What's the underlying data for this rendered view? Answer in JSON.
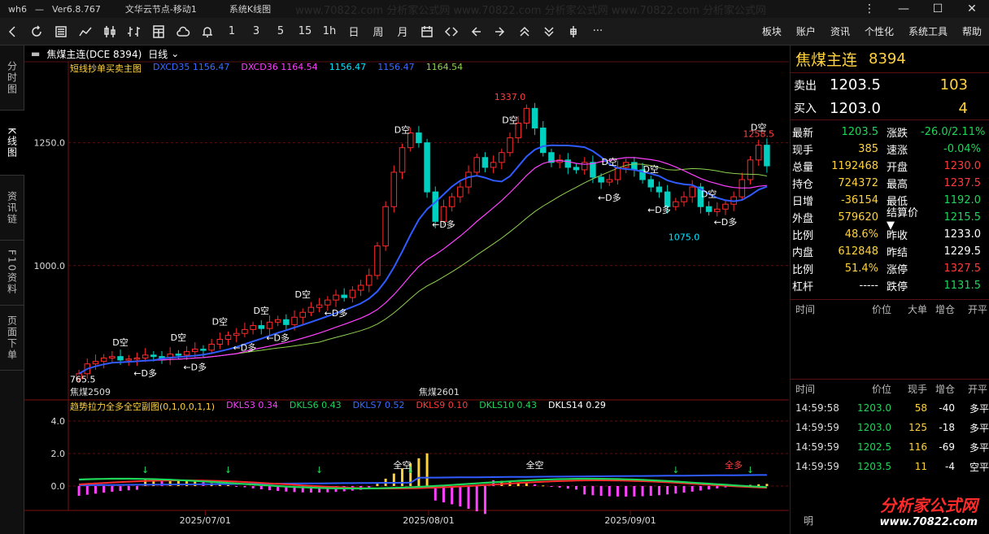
{
  "titlebar": {
    "app": "wh6",
    "dash": "—",
    "version": "Ver6.8.767",
    "tab1": "文华云节点-移动1",
    "tab2": "系统K线图",
    "watermark": "www.70822.com 分析家公式网 www.70822.com 分析家公式网 www.70822.com 分析家公式网"
  },
  "toolbar": {
    "periods": [
      "1",
      "3",
      "5",
      "15",
      "1h",
      "日",
      "周",
      "月"
    ],
    "menus": [
      "板块",
      "账户",
      "资讯",
      "个性化",
      "系统工具",
      "帮助"
    ],
    "more": "···"
  },
  "sidetabs": [
    "分时图",
    "K线图",
    "资讯链",
    "F10资料",
    "页面下单"
  ],
  "chart_header": {
    "symbol": "焦煤主连(DCE 8394)",
    "period": "日线"
  },
  "indicator_main": {
    "name": "短线抄单买卖主图",
    "items": [
      {
        "text": "DXCD35 1156.47",
        "color": "#3a6cff"
      },
      {
        "text": "DXCD36 1164.54",
        "color": "#ff40ff"
      },
      {
        "text": "1156.47",
        "color": "#00e5ff"
      },
      {
        "text": "1156.47",
        "color": "#3a6cff"
      },
      {
        "text": "1164.54",
        "color": "#8fd14f"
      }
    ]
  },
  "indicator_sub": {
    "name": "趋势拉力全多全空副图(0,1,0,0,1,1)",
    "items": [
      {
        "text": "DKLS3 0.34",
        "color": "#ff40ff"
      },
      {
        "text": "DKLS6 0.43",
        "color": "#1fd65a"
      },
      {
        "text": "DKLS7 0.52",
        "color": "#3a6cff"
      },
      {
        "text": "DKLS9 0.10",
        "color": "#ff3b3b"
      },
      {
        "text": "DKLS10 0.43",
        "color": "#1fd65a"
      },
      {
        "text": "DKLS14 0.29",
        "color": "#ffffff"
      }
    ]
  },
  "chart_labels": {
    "price_ticks": [
      "1250.0",
      "1000.0"
    ],
    "sub_ticks": [
      "4.0",
      "2.0",
      "0.0"
    ],
    "dates": [
      "2025/07/01",
      "2025/08/01",
      "2025/09/01"
    ],
    "contract1": "焦煤2509",
    "contract2": "焦煤2601",
    "high_label": "1258.5",
    "peak_label": "1337.0",
    "low_label": "1075.0",
    "start_label": "765.5",
    "d_kong": "D空",
    "d_duo": "←D多",
    "quan_kong": "全空",
    "quan_duo": "全多"
  },
  "chart_data": {
    "type": "candlestick",
    "title": "焦煤主连(DCE 8394) 日线",
    "x_ticks": [
      "2025/07/01",
      "2025/08/01",
      "2025/09/01"
    ],
    "y_ticks": [
      1250.0,
      1000.0
    ],
    "ylim": [
      740,
      1390
    ],
    "annotations": {
      "high": 1258.5,
      "peak": 1337.0,
      "low": 1075.0,
      "start": 765.5
    },
    "closes": [
      780,
      800,
      805,
      812,
      815,
      808,
      810,
      812,
      818,
      815,
      812,
      820,
      818,
      825,
      830,
      828,
      840,
      850,
      858,
      862,
      870,
      878,
      872,
      885,
      890,
      880,
      895,
      905,
      915,
      920,
      930,
      940,
      935,
      950,
      960,
      980,
      1040,
      1120,
      1190,
      1240,
      1270,
      1250,
      1150,
      1090,
      1120,
      1140,
      1160,
      1190,
      1220,
      1200,
      1210,
      1230,
      1260,
      1290,
      1320,
      1280,
      1230,
      1210,
      1215,
      1200,
      1195,
      1210,
      1180,
      1170,
      1175,
      1200,
      1210,
      1195,
      1175,
      1160,
      1150,
      1120,
      1130,
      1140,
      1160,
      1120,
      1110,
      1115,
      1125,
      1140,
      1175,
      1215,
      1245,
      1203
    ]
  },
  "right_panel": {
    "name": "焦煤主连",
    "code": "8394",
    "ask": {
      "label": "卖出",
      "price": "1203.5",
      "vol": "103"
    },
    "bid": {
      "label": "买入",
      "price": "1203.0",
      "vol": "4"
    },
    "quotes": [
      {
        "k": "最新",
        "v": "1203.5",
        "vc": "g",
        "k2": "涨跌",
        "v2": "-26.0/2.11%",
        "v2c": "g"
      },
      {
        "k": "现手",
        "v": "385",
        "vc": "y",
        "k2": "速涨",
        "v2": "-0.04%",
        "v2c": "g"
      },
      {
        "k": "总量",
        "v": "1192468",
        "vc": "y",
        "k2": "开盘",
        "v2": "1230.0",
        "v2c": "r"
      },
      {
        "k": "持仓",
        "v": "724372",
        "vc": "y",
        "k2": "最高",
        "v2": "1237.5",
        "v2c": "r"
      },
      {
        "k": "日增",
        "v": "-36154",
        "vc": "y",
        "k2": "最低",
        "v2": "1192.0",
        "v2c": "g"
      },
      {
        "k": "外盘",
        "v": "579620",
        "vc": "y",
        "k2": "结算价▼",
        "v2": "1215.5",
        "v2c": "g"
      },
      {
        "k": "比例",
        "v": "48.6%",
        "vc": "y",
        "k2": "昨收",
        "v2": "1233.0",
        "v2c": "w"
      },
      {
        "k": "内盘",
        "v": "612848",
        "vc": "y",
        "k2": "昨结",
        "v2": "1229.5",
        "v2c": "w"
      },
      {
        "k": "比例",
        "v": "51.4%",
        "vc": "y",
        "k2": "涨停",
        "v2": "1327.5",
        "v2c": "r"
      },
      {
        "k": "杠杆",
        "v": "-----",
        "vc": "w",
        "k2": "跌停",
        "v2": "1131.5",
        "v2c": "g"
      }
    ],
    "big_header": [
      "时间",
      "价位",
      "大单",
      "增仓",
      "开平"
    ],
    "tick_header": [
      "时间",
      "价位",
      "现手",
      "增仓",
      "开平"
    ],
    "ticks": [
      {
        "t": "14:59:58",
        "p": "1203.0",
        "pc": "g",
        "v": "58",
        "c": "-40",
        "k": "多平"
      },
      {
        "t": "14:59:59",
        "p": "1203.0",
        "pc": "g",
        "v": "125",
        "c": "-18",
        "k": "多平"
      },
      {
        "t": "14:59:59",
        "p": "1202.5",
        "pc": "g",
        "v": "116",
        "c": "-69",
        "k": "多平"
      },
      {
        "t": "14:59:59",
        "p": "1203.5",
        "pc": "g",
        "v": "11",
        "c": "-4",
        "k": "空平"
      }
    ],
    "logo1": "分析家公式网",
    "logo2": "www.70822.com",
    "bottom_tab": "明"
  }
}
